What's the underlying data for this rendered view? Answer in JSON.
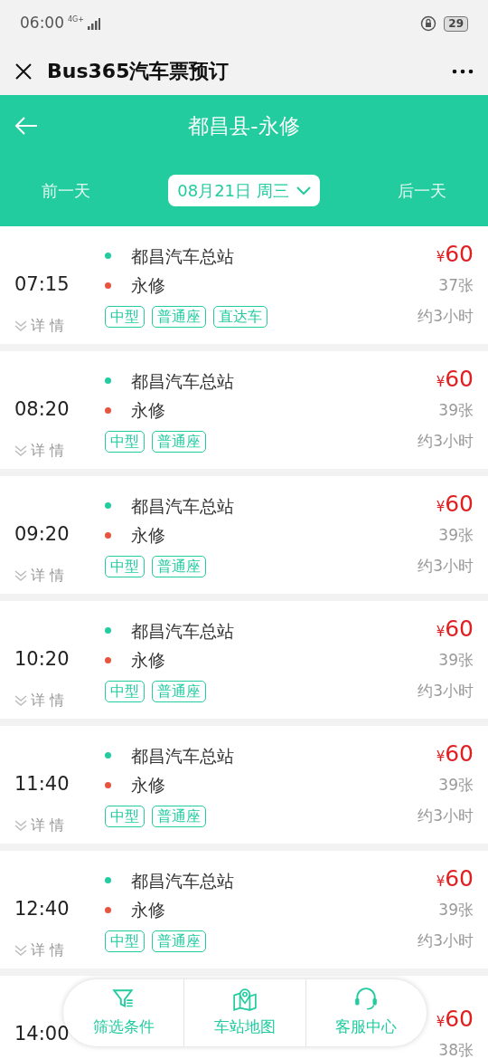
{
  "status_bar": {
    "time": "06:00",
    "network": "4G+",
    "battery": "29"
  },
  "title_bar": {
    "title": "Bus365汽车票预订"
  },
  "header": {
    "route": "都昌县-永修",
    "prev_day": "前一天",
    "date": "08月21日 周三",
    "next_day": "后一天"
  },
  "trips": [
    {
      "time": "07:15",
      "from": "都昌汽车总站",
      "to": "永修",
      "currency": "¥",
      "price": "60",
      "seats": "37张",
      "duration": "约3小时",
      "details": "详 情",
      "tags": [
        "中型",
        "普通座",
        "直达车"
      ]
    },
    {
      "time": "08:20",
      "from": "都昌汽车总站",
      "to": "永修",
      "currency": "¥",
      "price": "60",
      "seats": "39张",
      "duration": "约3小时",
      "details": "详 情",
      "tags": [
        "中型",
        "普通座"
      ]
    },
    {
      "time": "09:20",
      "from": "都昌汽车总站",
      "to": "永修",
      "currency": "¥",
      "price": "60",
      "seats": "39张",
      "duration": "约3小时",
      "details": "详 情",
      "tags": [
        "中型",
        "普通座"
      ]
    },
    {
      "time": "10:20",
      "from": "都昌汽车总站",
      "to": "永修",
      "currency": "¥",
      "price": "60",
      "seats": "39张",
      "duration": "约3小时",
      "details": "详 情",
      "tags": [
        "中型",
        "普通座"
      ]
    },
    {
      "time": "11:40",
      "from": "都昌汽车总站",
      "to": "永修",
      "currency": "¥",
      "price": "60",
      "seats": "39张",
      "duration": "约3小时",
      "details": "详 情",
      "tags": [
        "中型",
        "普通座"
      ]
    },
    {
      "time": "12:40",
      "from": "都昌汽车总站",
      "to": "永修",
      "currency": "¥",
      "price": "60",
      "seats": "39张",
      "duration": "约3小时",
      "details": "详 情",
      "tags": [
        "中型",
        "普通座"
      ]
    },
    {
      "time": "14:00",
      "currency": "¥",
      "price": "60",
      "seats": "38张"
    }
  ],
  "bottom_bar": [
    {
      "kind": "filter",
      "label": "筛选条件"
    },
    {
      "kind": "map",
      "label": "车站地图"
    },
    {
      "kind": "service",
      "label": "客服中心"
    }
  ]
}
